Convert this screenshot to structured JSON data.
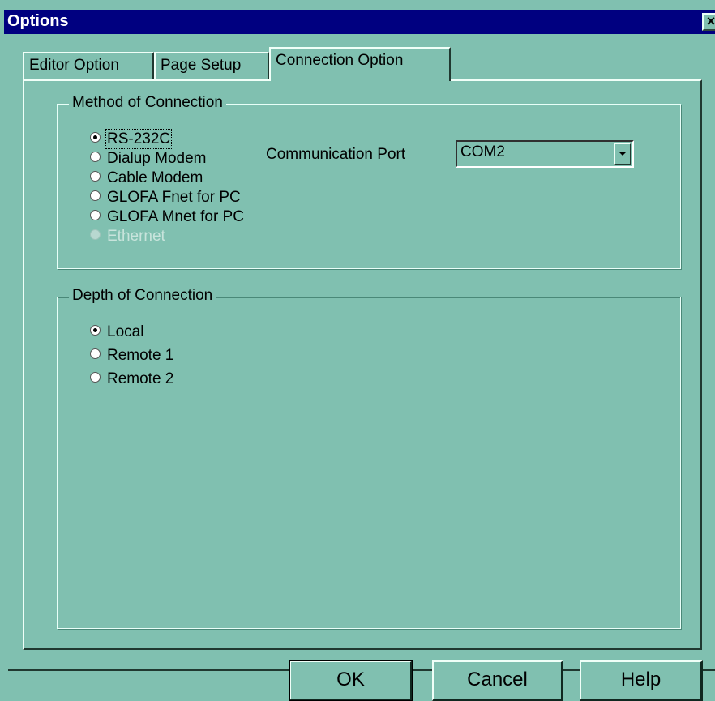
{
  "window": {
    "title": "Options",
    "close_glyph": "×"
  },
  "tabs": [
    {
      "label": "Editor Option",
      "active": false
    },
    {
      "label": "Page Setup",
      "active": false
    },
    {
      "label": "Connection Option",
      "active": true
    }
  ],
  "method_group": {
    "legend": "Method of Connection",
    "options": [
      {
        "label": "RS-232C",
        "checked": true,
        "disabled": false
      },
      {
        "label": "Dialup Modem",
        "checked": false,
        "disabled": false
      },
      {
        "label": "Cable Modem",
        "checked": false,
        "disabled": false
      },
      {
        "label": "GLOFA Fnet for PC",
        "checked": false,
        "disabled": false
      },
      {
        "label": "GLOFA Mnet for PC",
        "checked": false,
        "disabled": false
      },
      {
        "label": "Ethernet",
        "checked": false,
        "disabled": true
      }
    ],
    "port_label": "Communication Port",
    "port_value": "COM2"
  },
  "depth_group": {
    "legend": "Depth of Connection",
    "options": [
      {
        "label": "Local",
        "checked": true
      },
      {
        "label": "Remote 1",
        "checked": false
      },
      {
        "label": "Remote 2",
        "checked": false
      }
    ]
  },
  "buttons": {
    "ok": "OK",
    "cancel": "Cancel",
    "help": "Help"
  },
  "colors": {
    "face": "#80c0b0",
    "titlebar": "#000080",
    "title_text": "#ffffff"
  }
}
